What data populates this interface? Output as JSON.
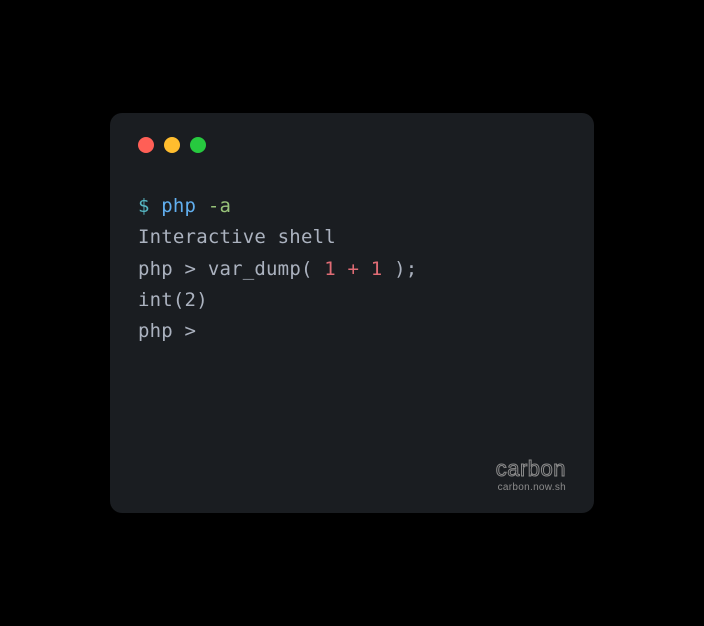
{
  "traffic_lights": {
    "red": "#ff5f56",
    "yellow": "#ffbd2e",
    "green": "#27c93f"
  },
  "code": {
    "line1": {
      "dollar": "$ ",
      "cmd": "php ",
      "flag": "-a"
    },
    "line2": "Interactive shell",
    "line3": "",
    "line4": {
      "prompt": "php > ",
      "fn_open": "var_dump( ",
      "num1": "1",
      "space1": " ",
      "op": "+",
      "space2": " ",
      "num2": "1",
      "fn_close": " );"
    },
    "line5": "int(2)",
    "line6": "php > "
  },
  "watermark": {
    "title": "carbon",
    "url": "carbon.now.sh"
  }
}
